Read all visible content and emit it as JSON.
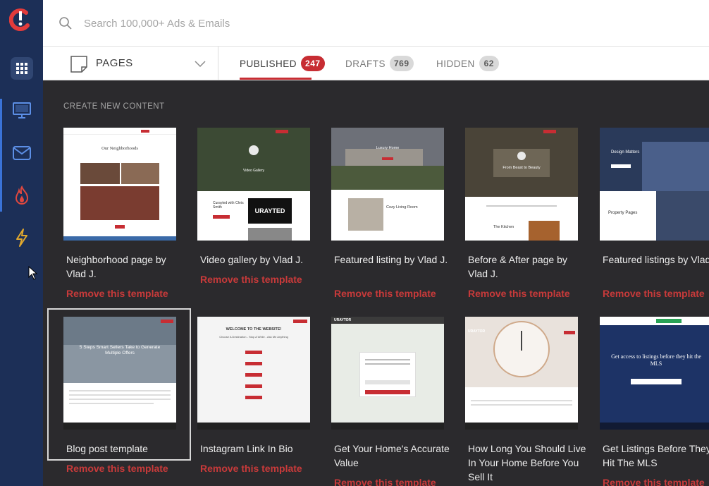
{
  "search": {
    "placeholder": "Search 100,000+ Ads & Emails"
  },
  "pages_select": {
    "label": "PAGES"
  },
  "tabs": [
    {
      "label": "PUBLISHED",
      "count": "247",
      "active": true
    },
    {
      "label": "DRAFTS",
      "count": "769",
      "active": false
    },
    {
      "label": "HIDDEN",
      "count": "62",
      "active": false
    }
  ],
  "section": {
    "title": "CREATE NEW CONTENT"
  },
  "remove_label": "Remove this template",
  "cards": [
    {
      "title": "Neighborhood page by Vlad J.",
      "thumb_heading": "Our Neighborhoods"
    },
    {
      "title": "Video gallery by Vlad J.",
      "thumb_heading": "Video Gallery",
      "thumb_sub": "Curayted with Chris Smith",
      "thumb_logo": "URAYTED"
    },
    {
      "title": "Featured listing by Vlad J.",
      "thumb_heading": "Luxury Home",
      "thumb_sub": "Cozy Living Room"
    },
    {
      "title": "Before & After page by Vlad J.",
      "thumb_heading": "From Beast to Beauty",
      "thumb_sub": "The Kitchen"
    },
    {
      "title": "Featured listings by Vlad J.",
      "thumb_heading": "Design Matters",
      "thumb_sub": "Property Pages"
    },
    {
      "title": "Blog post template",
      "thumb_heading": "5 Steps Smart Sellers Take to Generate Multiple Offers"
    },
    {
      "title": "Instagram Link In Bio",
      "thumb_heading": "WELCOME TO THE WEBSITE!",
      "thumb_sub": "Choose A Destination - Stop A While - Ask Me Anything"
    },
    {
      "title": "Get Your Home's Accurate Value",
      "thumb_heading": "URAYTOR"
    },
    {
      "title": "How Long You Should Live In Your Home Before You Sell It",
      "thumb_heading": "URAYTOR"
    },
    {
      "title": "Get Listings Before They Hit The MLS",
      "thumb_heading": "Get access to listings before they hit the MLS"
    }
  ],
  "colors": {
    "sidebar": "#1c2f57",
    "accent": "#c72d33",
    "content_bg": "#2b2a2d"
  },
  "icons": [
    "logo-icon",
    "apps-grid-icon",
    "monitor-icon",
    "mail-icon",
    "fire-icon",
    "bolt-icon",
    "search-icon",
    "page-icon",
    "chevron-down-icon"
  ]
}
